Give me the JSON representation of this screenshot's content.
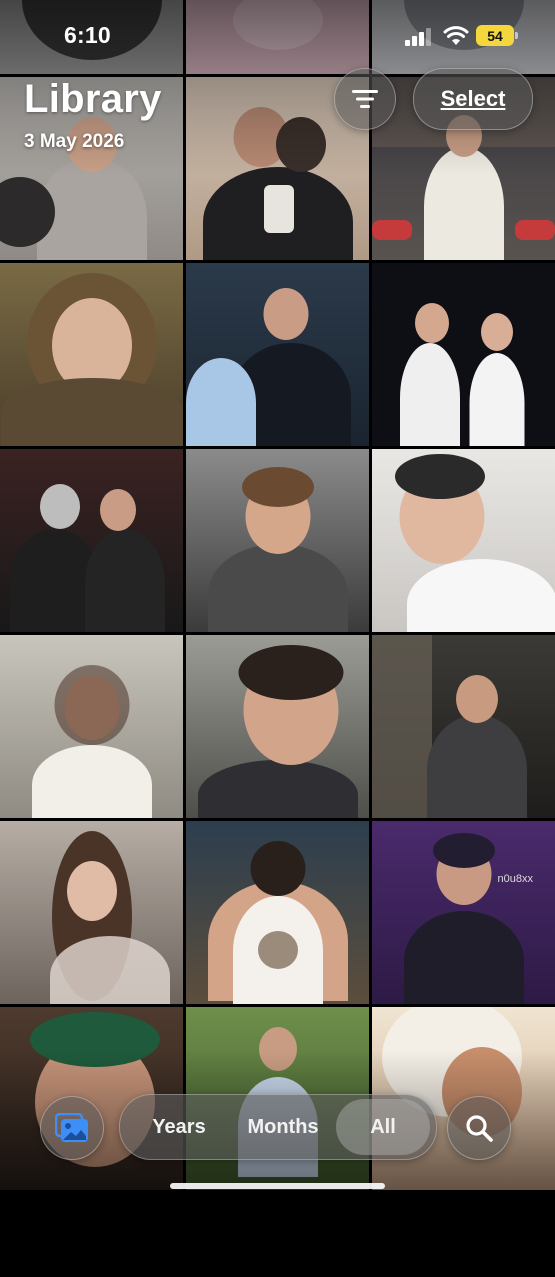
{
  "status_bar": {
    "time": "6:10",
    "battery": "54"
  },
  "header": {
    "title": "Library",
    "date": "3 May 2026",
    "select_label": "Select"
  },
  "photo_watermark": "n0u8xx",
  "bottom_bar": {
    "segments": [
      {
        "label": "Years",
        "selected": false
      },
      {
        "label": "Months",
        "selected": false
      },
      {
        "label": "All",
        "selected": true
      }
    ]
  },
  "icons": {
    "filter": "filter-icon",
    "photos": "photo-library-icon",
    "search": "search-icon"
  },
  "colors": {
    "battery": "#f3d73c",
    "background": "#000000"
  }
}
